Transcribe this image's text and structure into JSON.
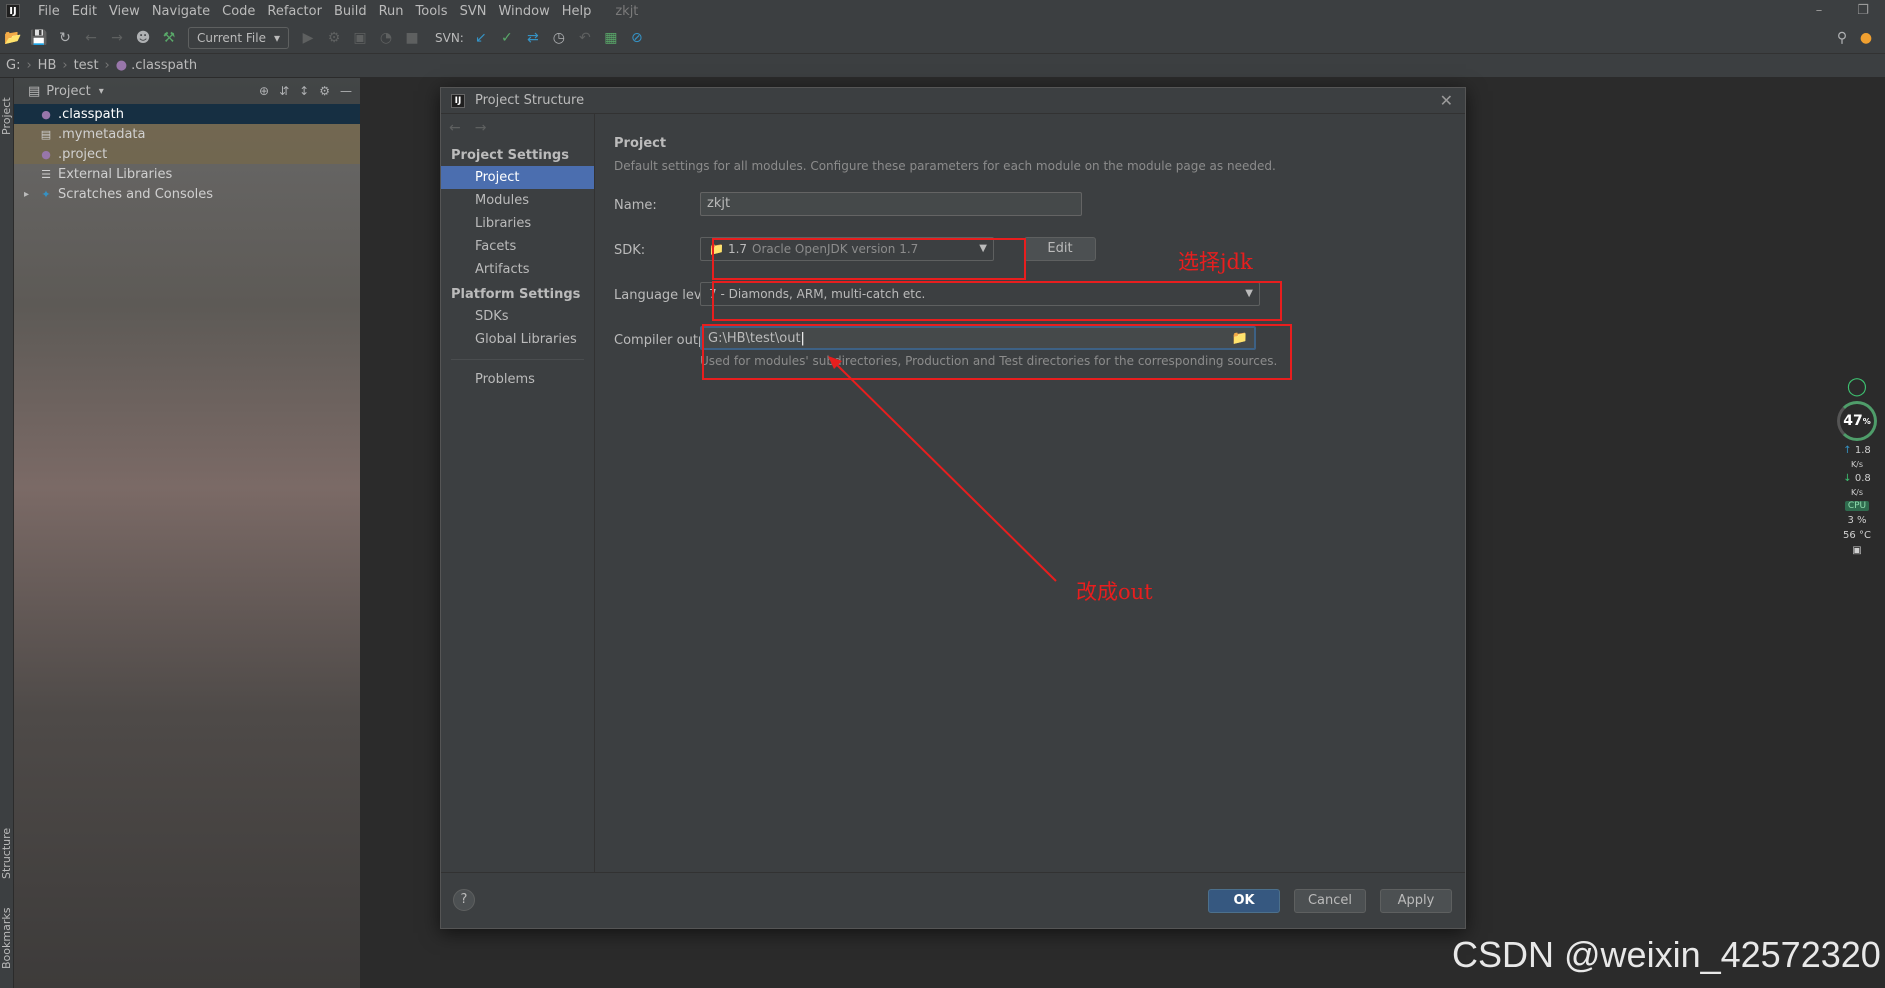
{
  "menubar": {
    "logo": "IJ",
    "items": [
      "File",
      "Edit",
      "View",
      "Navigate",
      "Code",
      "Refactor",
      "Build",
      "Run",
      "Tools",
      "SVN",
      "Window",
      "Help"
    ],
    "project_name": "zkjt"
  },
  "toolbar": {
    "run_config": "Current File",
    "svn_label": "SVN:"
  },
  "navbar": {
    "drive": "G:",
    "crumbs": [
      "HB",
      "test",
      ".classpath"
    ]
  },
  "left_strip": {
    "project_label": "Project",
    "structure_label": "Structure",
    "bookmarks_label": "Bookmarks"
  },
  "project_panel": {
    "title": "Project",
    "items": [
      {
        "label": ".classpath",
        "icon": "eclipse-file-icon"
      },
      {
        "label": ".mymetadata",
        "icon": "file-icon"
      },
      {
        "label": ".project",
        "icon": "eclipse-file-icon"
      },
      {
        "label": "External Libraries",
        "icon": "library-icon"
      },
      {
        "label": "Scratches and Consoles",
        "icon": "scratches-icon"
      }
    ]
  },
  "dialog": {
    "title": "Project Structure",
    "sidebar": {
      "group1": "Project Settings",
      "group1_items": [
        "Project",
        "Modules",
        "Libraries",
        "Facets",
        "Artifacts"
      ],
      "group2": "Platform Settings",
      "group2_items": [
        "SDKs",
        "Global Libraries"
      ],
      "problems": "Problems"
    },
    "main": {
      "section_title": "Project",
      "section_desc": "Default settings for all modules. Configure these parameters for each module on the module page as needed.",
      "name_label": "Name:",
      "name_value": "zkjt",
      "sdk_label": "SDK:",
      "sdk_value_version": "1.7",
      "sdk_value_name": "Oracle OpenJDK version 1.7",
      "edit_label": "Edit",
      "language_label": "Language level:",
      "language_value": "7 - Diamonds, ARM, multi-catch etc.",
      "compiler_label": "Compiler output:",
      "compiler_value": "G:\\HB\\test\\out",
      "compiler_hint": "Used for modules' subdirectories, Production and Test directories for the corresponding sources."
    },
    "footer": {
      "help": "?",
      "ok": "OK",
      "cancel": "Cancel",
      "apply": "Apply"
    }
  },
  "annotations": {
    "select_jdk": "选择jdk",
    "change_to_out": "改成out",
    "color": "#e81e1e"
  },
  "system_widget": {
    "percent": "47",
    "percent_unit": "%",
    "up_speed": "1.8",
    "down_speed": "0.8",
    "speed_unit": "K/s",
    "cpu_label": "CPU",
    "cpu_value": "3 %",
    "temp_value": "56 °C"
  },
  "watermark": "CSDN @weixin_42572320"
}
